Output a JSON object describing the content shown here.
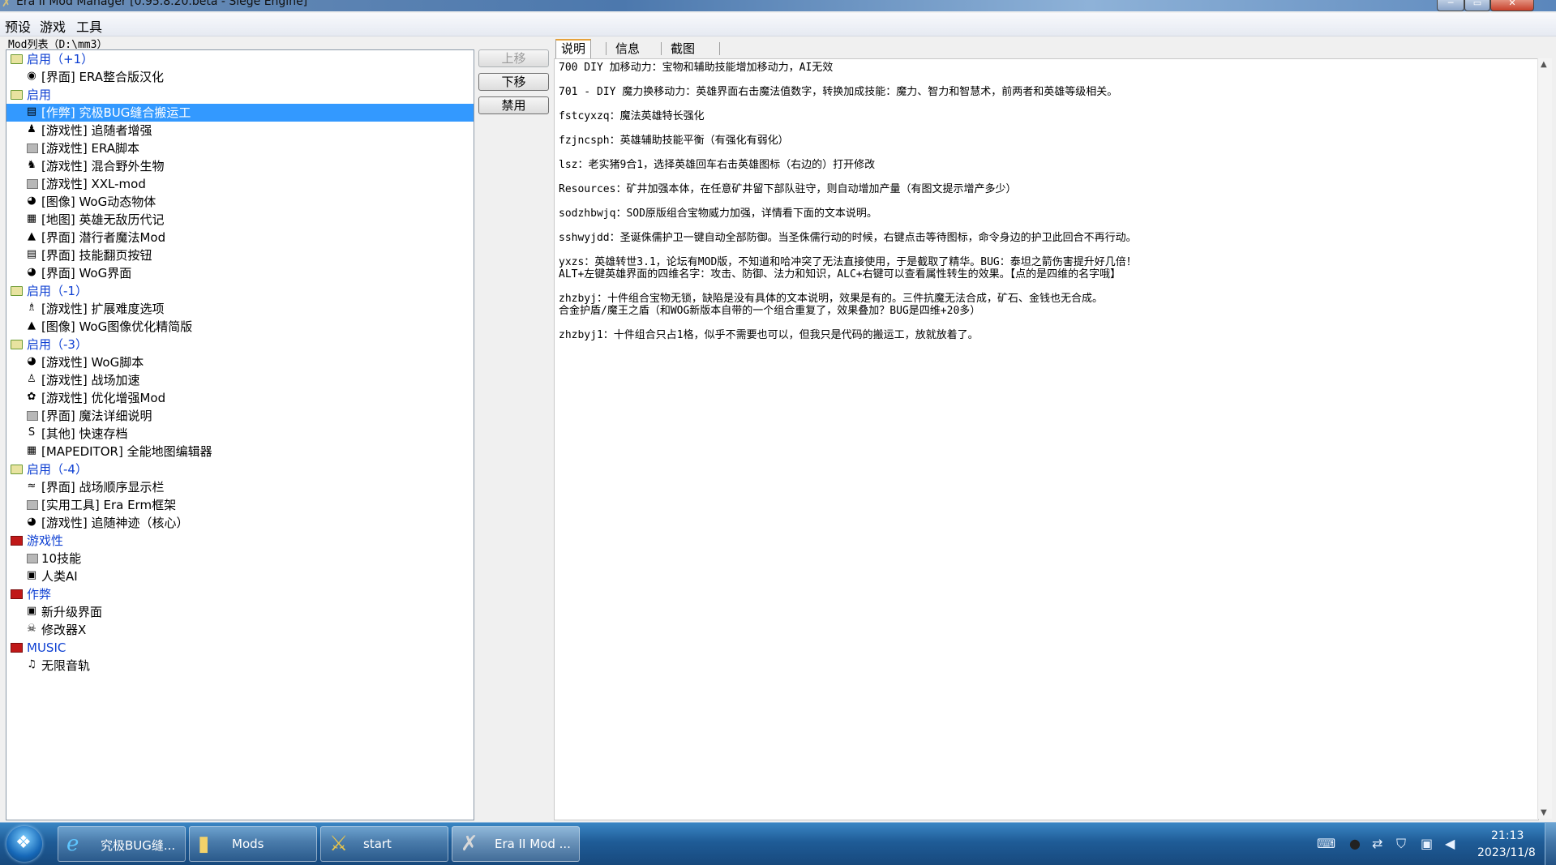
{
  "window": {
    "title": "Era II Mod Manager [0.95.8.20.beta - Siege Engine]",
    "min_icon": "─",
    "max_icon": "▭",
    "close_icon": "✕"
  },
  "menu": [
    "预设",
    "游戏",
    "工具"
  ],
  "modlist": {
    "label": "Mod列表（D:\\mm3）",
    "rows": [
      {
        "type": "group",
        "label": "启用（+1）",
        "icon": "folder-green-icon"
      },
      {
        "type": "item",
        "label": "[界面] ERA整合版汉化",
        "icon": "globe-icon",
        "glyph": "◉"
      },
      {
        "type": "group",
        "label": "启用",
        "icon": "folder-green-icon"
      },
      {
        "type": "item",
        "label": "[作弊] 究极BUG缝合搬运工",
        "icon": "book-icon",
        "glyph": "▤",
        "selected": true
      },
      {
        "type": "item",
        "label": "[游戏性] 追随者增强",
        "icon": "person-icon",
        "glyph": "♟"
      },
      {
        "type": "item",
        "label": "[游戏性] ERA脚本",
        "icon": "default-mod-icon",
        "glyph": ""
      },
      {
        "type": "item",
        "label": "[游戏性] 混合野外生物",
        "icon": "creature-icon",
        "glyph": "♞"
      },
      {
        "type": "item",
        "label": "[游戏性] XXL-mod",
        "icon": "default-mod-icon",
        "glyph": ""
      },
      {
        "type": "item",
        "label": "[图像] WoG动态物体",
        "icon": "eye-icon",
        "glyph": "◕"
      },
      {
        "type": "item",
        "label": "[地图] 英雄无敌历代记",
        "icon": "map-icon",
        "glyph": "▦"
      },
      {
        "type": "item",
        "label": "[界面] 潜行者魔法Mod",
        "icon": "hat-icon",
        "glyph": "▲"
      },
      {
        "type": "item",
        "label": "[界面] 技能翻页按钮",
        "icon": "page-icon",
        "glyph": "▤"
      },
      {
        "type": "item",
        "label": "[界面] WoG界面",
        "icon": "eye-icon",
        "glyph": "◕"
      },
      {
        "type": "group",
        "label": "启用（-1）",
        "icon": "folder-green-icon"
      },
      {
        "type": "item",
        "label": "[游戏性] 扩展难度选项",
        "icon": "figure-icon",
        "glyph": "♗"
      },
      {
        "type": "item",
        "label": "[图像] WoG图像优化精简版",
        "icon": "hat-icon",
        "glyph": "▲"
      },
      {
        "type": "group",
        "label": "启用（-3）",
        "icon": "folder-green-icon"
      },
      {
        "type": "item",
        "label": "[游戏性] WoG脚本",
        "icon": "eye-icon",
        "glyph": "◕"
      },
      {
        "type": "item",
        "label": "[游戏性] 战场加速",
        "icon": "runner-icon",
        "glyph": "♙"
      },
      {
        "type": "item",
        "label": "[游戏性] 优化增强Mod",
        "icon": "gear-icon",
        "glyph": "✿"
      },
      {
        "type": "item",
        "label": "[界面] 魔法详细说明",
        "icon": "default-mod-icon",
        "glyph": ""
      },
      {
        "type": "item",
        "label": "[其他] 快速存档",
        "icon": "save-icon",
        "glyph": "S"
      },
      {
        "type": "item",
        "label": "[MAPEDITOR] 全能地图编辑器",
        "icon": "map-editor-icon",
        "glyph": "▦"
      },
      {
        "type": "group",
        "label": "启用（-4）",
        "icon": "folder-green-icon"
      },
      {
        "type": "item",
        "label": "[界面] 战场顺序显示栏",
        "icon": "wings-icon",
        "glyph": "≈"
      },
      {
        "type": "item",
        "label": "[实用工具] Era Erm框架",
        "icon": "default-mod-icon",
        "glyph": ""
      },
      {
        "type": "item",
        "label": "[游戏性] 追随神迹（核心）",
        "icon": "eye-icon",
        "glyph": "◕"
      },
      {
        "type": "group",
        "label": "游戏性",
        "icon": "folder-red-icon"
      },
      {
        "type": "item",
        "label": "10技能",
        "icon": "default-mod-icon",
        "glyph": ""
      },
      {
        "type": "item",
        "label": "人类AI",
        "icon": "portrait-icon",
        "glyph": "▣"
      },
      {
        "type": "group",
        "label": "作弊",
        "icon": "folder-red-icon"
      },
      {
        "type": "item",
        "label": "新升级界面",
        "icon": "upgrade-icon",
        "glyph": "▣"
      },
      {
        "type": "item",
        "label": "修改器X",
        "icon": "skull-icon",
        "glyph": "☠"
      },
      {
        "type": "group",
        "label": "MUSIC",
        "icon": "folder-red-icon"
      },
      {
        "type": "item",
        "label": "无限音轨",
        "icon": "music-icon",
        "glyph": "♫"
      }
    ]
  },
  "buttons": {
    "up": "上移",
    "down": "下移",
    "disable": "禁用"
  },
  "tabs": [
    "说明",
    "信息",
    "截图"
  ],
  "description": [
    {
      "key": "l0",
      "text": "700 DIY 加移动力：宝物和辅助技能增加移动力，AI无效"
    },
    {
      "key": "l1",
      "text": "701 - DIY  魔力换移动力：英雄界面右击魔法值数字，转换加成技能：魔力、智力和智慧术，前两者和英雄等级相关。"
    },
    {
      "key": "l2",
      "text": "fstcyxzq：魔法英雄特长强化"
    },
    {
      "key": "l3",
      "text": "fzjncsph：英雄辅助技能平衡（有强化有弱化）"
    },
    {
      "key": "l4",
      "text": "lsz：老实猪9合1，选择英雄回车右击英雄图标（右边的）打开修改"
    },
    {
      "key": "l5",
      "text": "Resources：矿井加强本体，在任意矿井留下部队驻守，则自动增加产量（有图文提示增产多少）"
    },
    {
      "key": "l6",
      "text": "sodzhbwjq：SOD原版组合宝物威力加强，详情看下面的文本说明。"
    },
    {
      "key": "l7",
      "text": "sshwyjdd：圣诞侏儒护卫一键自动全部防御。当圣侏儒行动的时候，右键点击等待图标，命令身边的护卫此回合不再行动。"
    },
    {
      "key": "l8",
      "text": "yxzs：英雄转世3.1，论坛有MOD版，不知道和哈冲突了无法直接使用，于是截取了精华。BUG：泰坦之箭伤害提升好几倍！"
    },
    {
      "key": "l9",
      "text": "ALT+左键英雄界面的四维名字：攻击、防御、法力和知识，ALC+右键可以查看属性转生的效果。【点的是四维的名字哦】"
    },
    {
      "key": "l10",
      "text": "zhzbyj：十件组合宝物无锁，缺陷是没有具体的文本说明，效果是有的。三件抗魔无法合成，矿石、金钱也无合成。"
    },
    {
      "key": "l11",
      "text": "合金护盾/魔王之盾（和WOG新版本自带的一个组合重复了，效果叠加？BUG是四维+20多）"
    },
    {
      "key": "l12",
      "text": "zhzbyj1：十件组合只占1格，似乎不需要也可以，但我只是代码的搬运工，放就放着了。"
    }
  ],
  "taskbar": {
    "start_icon": "❖",
    "tasks": [
      {
        "label": "究极BUG缝...",
        "icon": "ie-icon",
        "glyph": "e"
      },
      {
        "label": "Mods",
        "icon": "folder-icon",
        "glyph": "▮"
      },
      {
        "label": "start",
        "icon": "sword-icon",
        "glyph": "⚔"
      },
      {
        "label": "Era II Mod ...",
        "icon": "tools-icon",
        "glyph": "✗"
      }
    ],
    "tray": [
      {
        "icon": "keyboard-icon",
        "glyph": "⌨"
      },
      {
        "icon": "qq-penguin-icon",
        "glyph": "●"
      },
      {
        "icon": "network-arrow-icon",
        "glyph": "⇄"
      },
      {
        "icon": "shield-icon",
        "glyph": "⛉"
      },
      {
        "icon": "network-icon",
        "glyph": "▣"
      },
      {
        "icon": "volume-icon",
        "glyph": "◀"
      }
    ],
    "time": "21:13",
    "date": "2023/11/8"
  }
}
